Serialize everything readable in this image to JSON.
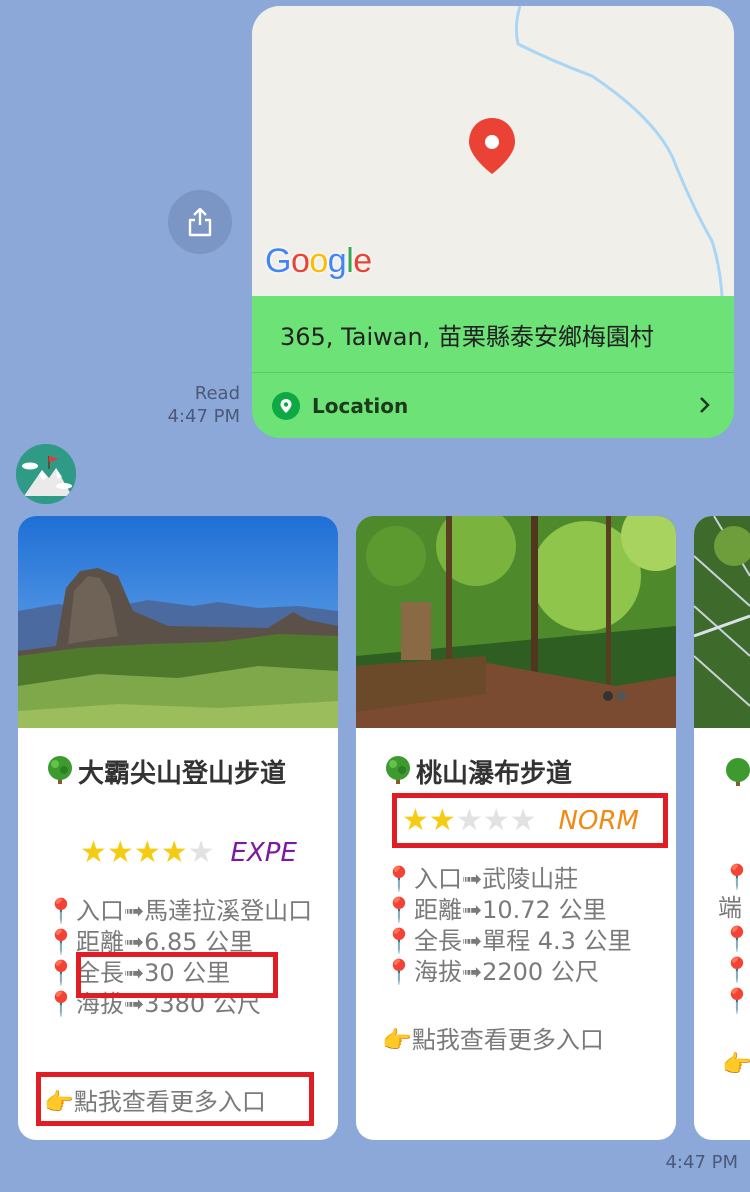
{
  "location_message": {
    "map_brand": "Google",
    "address": "365, Taiwan, 苗栗縣泰安鄉梅園村",
    "footer_label": "Location",
    "status": "Read",
    "time": "4:47 PM"
  },
  "cards": [
    {
      "title": "大霸尖山登山步道",
      "rating": 4,
      "level": "EXPE",
      "level_color": "#7b1aa0",
      "entrance": "入口➟馬達拉溪登山口",
      "distance": "距離➟6.85 公里",
      "length": "全長➟30 公里",
      "altitude": "海拔➟3380 公尺",
      "more": "👉點我查看更多入口"
    },
    {
      "title": "桃山瀑布步道",
      "rating": 2,
      "level": "NORM",
      "level_color": "#f28a12",
      "entrance": "入口➟武陵山莊",
      "distance": "距離➟10.72 公里",
      "length": "全長➟單程 4.3 公里",
      "altitude": "海拔➟2200 公尺",
      "more": "👉點我查看更多入口"
    },
    {
      "partial_text": "端"
    }
  ],
  "carousel_time": "4:47 PM",
  "colors": {
    "background": "#8ba8d8",
    "bubble_green": "#6ce277",
    "highlight_red": "#e01d25",
    "star_yellow": "#f6cc13"
  }
}
